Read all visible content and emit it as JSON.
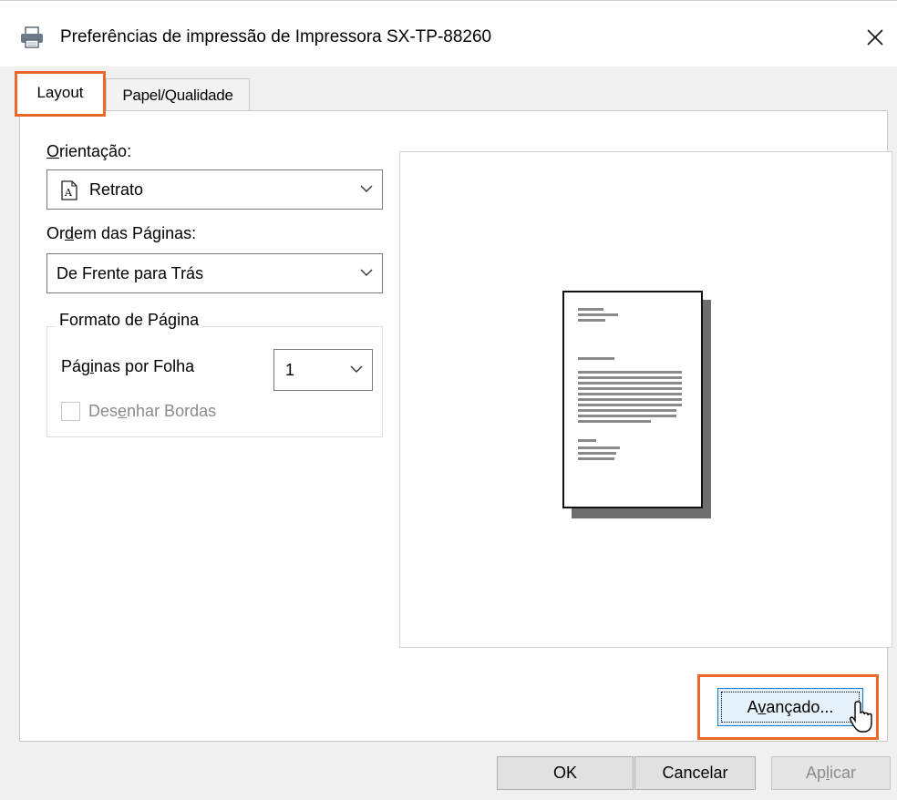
{
  "window": {
    "title": "Preferências de impressão de Impressora SX-TP-88260",
    "close_glyph": "✕"
  },
  "tabs": [
    {
      "label": "Layout",
      "selected": true
    },
    {
      "label": "Papel/Qualidade",
      "selected": false
    }
  ],
  "layout": {
    "orientation": {
      "label_prefix": "",
      "label_mnemonic": "O",
      "label_rest": "rientação:",
      "value": "Retrato",
      "value_icon": "portrait-page-icon"
    },
    "page_order": {
      "label_prefix": "Or",
      "label_mnemonic": "d",
      "label_rest": "em das Páginas:",
      "value": "De Frente para Trás"
    },
    "page_format": {
      "group_title": "Formato de Página",
      "pages_per_sheet": {
        "label_prefix": "Pág",
        "label_mnemonic": "i",
        "label_rest": "nas por Folha",
        "value": "1"
      },
      "draw_borders": {
        "label_prefix": "Des",
        "label_mnemonic": "e",
        "label_rest": "nhar Bordas",
        "checked": false,
        "enabled": false
      }
    },
    "advanced_button": {
      "label_prefix": "A",
      "label_mnemonic": "v",
      "label_rest": "ançado..."
    }
  },
  "footer": {
    "ok_label": "OK",
    "cancel_label": "Cancelar",
    "apply_label_prefix": "Ap",
    "apply_label_mnemonic": "l",
    "apply_label_rest": "icar"
  },
  "colors": {
    "highlight": "#e8692b",
    "focus_blue": "#0078d7"
  }
}
